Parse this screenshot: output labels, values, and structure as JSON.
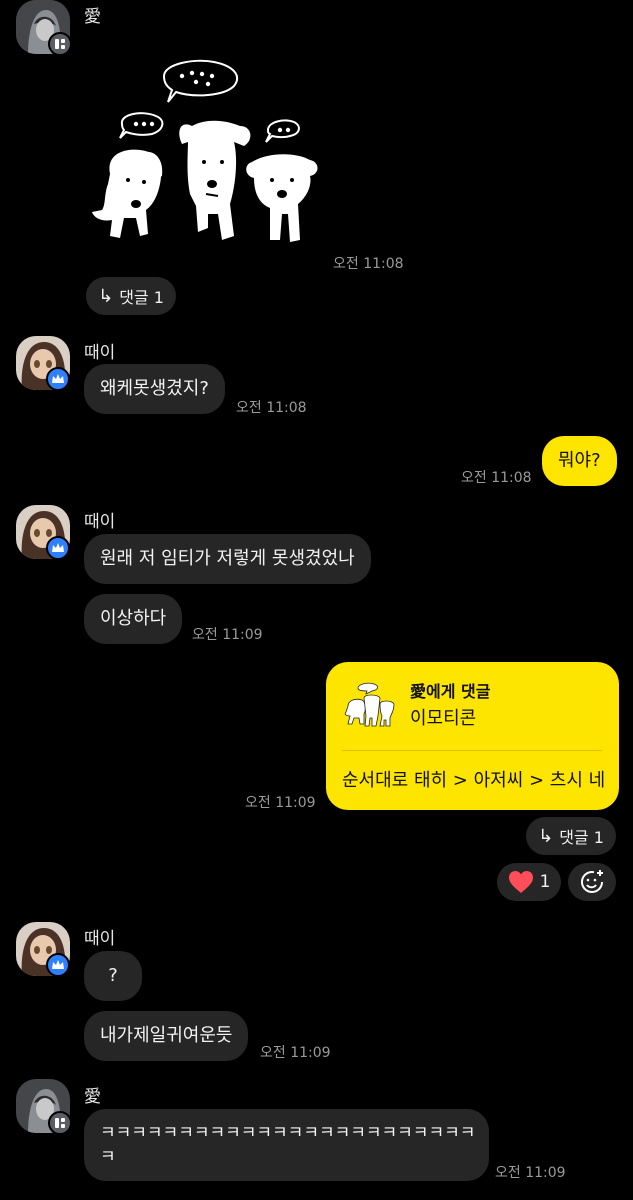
{
  "colors": {
    "background": "#000000",
    "bubble_other": "#262626",
    "bubble_me": "#fee500",
    "heart": "#ff4d5a",
    "badge_blue": "#2f80ff"
  },
  "m1": {
    "sender": "愛",
    "time": "오전 11:08",
    "reply_label": "댓글 1"
  },
  "m2": {
    "sender": "때이",
    "text": "왜케못생겼지?",
    "time": "오전 11:08"
  },
  "m3": {
    "text": "뭐야?",
    "time": "오전 11:08"
  },
  "m4": {
    "sender": "때이",
    "text1": "원래 저 임티가 저렇게 못생겼었나",
    "text2": "이상하다",
    "time": "오전 11:09"
  },
  "m5": {
    "quote_title": "愛에게 댓글",
    "quote_sub": "이모티콘",
    "text": "순서대로 태히 > 아저씨 > 츠시 네",
    "time": "오전 11:09",
    "reply_label": "댓글 1",
    "reaction_count": "1"
  },
  "m6": {
    "sender": "때이",
    "text1": "?",
    "text2": "내가제일귀여운듯",
    "time": "오전 11:09"
  },
  "m7": {
    "sender": "愛",
    "line1": "ㅋㅋㅋㅋㅋㅋㅋㅋㅋㅋㅋㅋㅋㅋㅋㅋㅋㅋㅋㅋㅋㅋㅋㅋㅋ",
    "line2": "ㅋ",
    "time": "오전 11:09"
  }
}
